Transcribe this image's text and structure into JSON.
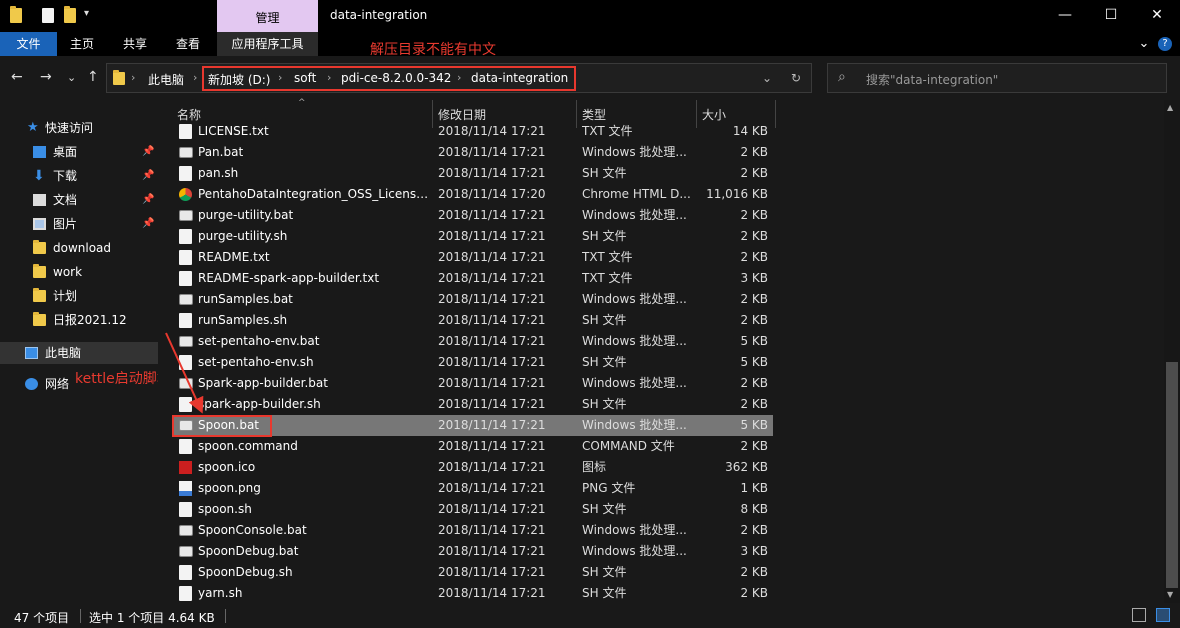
{
  "window": {
    "title": "data-integration",
    "context_tab": "管理",
    "minimize": "—",
    "maximize": "☐",
    "close": "✕"
  },
  "ribbon": {
    "tabs": [
      "文件",
      "主页",
      "共享",
      "查看",
      "应用程序工具"
    ],
    "collapse": "⌄",
    "help": "?"
  },
  "annotations": {
    "address_note": "解压目录不能有中文",
    "kettle_note": "kettle启动脚本"
  },
  "nav": {
    "back": "←",
    "forward": "→",
    "recent": "⌄",
    "up": "↑"
  },
  "address": {
    "crumbs": [
      "此电脑",
      "新加坡 (D:)",
      "soft",
      "pdi-ce-8.2.0.0-342",
      "data-integration"
    ],
    "separator": "›",
    "dropdown": "⌄",
    "refresh": "↻"
  },
  "search": {
    "placeholder": "搜索\"data-integration\"",
    "icon": "⌕"
  },
  "navpane": {
    "quick_access": "快速访问",
    "items": [
      {
        "label": "桌面",
        "pinned": true
      },
      {
        "label": "下载",
        "pinned": true
      },
      {
        "label": "文档",
        "pinned": true
      },
      {
        "label": "图片",
        "pinned": true
      },
      {
        "label": "download",
        "pinned": false
      },
      {
        "label": "work",
        "pinned": false
      },
      {
        "label": "计划",
        "pinned": false
      },
      {
        "label": "日报2021.12",
        "pinned": false
      }
    ],
    "this_pc": "此电脑",
    "network": "网络",
    "pin_glyph": "📌"
  },
  "columns": {
    "name": "名称",
    "date": "修改日期",
    "type": "类型",
    "size": "大小"
  },
  "files": [
    {
      "name": "LICENSE.txt",
      "date": "2018/11/14 17:21",
      "type": "TXT 文件",
      "size": "14 KB",
      "icon": "txt"
    },
    {
      "name": "Pan.bat",
      "date": "2018/11/14 17:21",
      "type": "Windows 批处理...",
      "size": "2 KB",
      "icon": "bat"
    },
    {
      "name": "pan.sh",
      "date": "2018/11/14 17:21",
      "type": "SH 文件",
      "size": "2 KB",
      "icon": "txt"
    },
    {
      "name": "PentahoDataIntegration_OSS_License...",
      "date": "2018/11/14 17:20",
      "type": "Chrome HTML D...",
      "size": "11,016 KB",
      "icon": "chrome"
    },
    {
      "name": "purge-utility.bat",
      "date": "2018/11/14 17:21",
      "type": "Windows 批处理...",
      "size": "2 KB",
      "icon": "bat"
    },
    {
      "name": "purge-utility.sh",
      "date": "2018/11/14 17:21",
      "type": "SH 文件",
      "size": "2 KB",
      "icon": "txt"
    },
    {
      "name": "README.txt",
      "date": "2018/11/14 17:21",
      "type": "TXT 文件",
      "size": "2 KB",
      "icon": "txt"
    },
    {
      "name": "README-spark-app-builder.txt",
      "date": "2018/11/14 17:21",
      "type": "TXT 文件",
      "size": "3 KB",
      "icon": "txt"
    },
    {
      "name": "runSamples.bat",
      "date": "2018/11/14 17:21",
      "type": "Windows 批处理...",
      "size": "2 KB",
      "icon": "bat"
    },
    {
      "name": "runSamples.sh",
      "date": "2018/11/14 17:21",
      "type": "SH 文件",
      "size": "2 KB",
      "icon": "txt"
    },
    {
      "name": "set-pentaho-env.bat",
      "date": "2018/11/14 17:21",
      "type": "Windows 批处理...",
      "size": "5 KB",
      "icon": "bat"
    },
    {
      "name": "set-pentaho-env.sh",
      "date": "2018/11/14 17:21",
      "type": "SH 文件",
      "size": "5 KB",
      "icon": "txt"
    },
    {
      "name": "Spark-app-builder.bat",
      "date": "2018/11/14 17:21",
      "type": "Windows 批处理...",
      "size": "2 KB",
      "icon": "bat"
    },
    {
      "name": "spark-app-builder.sh",
      "date": "2018/11/14 17:21",
      "type": "SH 文件",
      "size": "2 KB",
      "icon": "txt"
    },
    {
      "name": "Spoon.bat",
      "date": "2018/11/14 17:21",
      "type": "Windows 批处理...",
      "size": "5 KB",
      "icon": "bat",
      "selected": true
    },
    {
      "name": "spoon.command",
      "date": "2018/11/14 17:21",
      "type": "COMMAND 文件",
      "size": "2 KB",
      "icon": "txt"
    },
    {
      "name": "spoon.ico",
      "date": "2018/11/14 17:21",
      "type": "图标",
      "size": "362 KB",
      "icon": "ico"
    },
    {
      "name": "spoon.png",
      "date": "2018/11/14 17:21",
      "type": "PNG 文件",
      "size": "1 KB",
      "icon": "png"
    },
    {
      "name": "spoon.sh",
      "date": "2018/11/14 17:21",
      "type": "SH 文件",
      "size": "8 KB",
      "icon": "txt"
    },
    {
      "name": "SpoonConsole.bat",
      "date": "2018/11/14 17:21",
      "type": "Windows 批处理...",
      "size": "2 KB",
      "icon": "bat"
    },
    {
      "name": "SpoonDebug.bat",
      "date": "2018/11/14 17:21",
      "type": "Windows 批处理...",
      "size": "3 KB",
      "icon": "bat"
    },
    {
      "name": "SpoonDebug.sh",
      "date": "2018/11/14 17:21",
      "type": "SH 文件",
      "size": "2 KB",
      "icon": "txt"
    },
    {
      "name": "yarn.sh",
      "date": "2018/11/14 17:21",
      "type": "SH 文件",
      "size": "2 KB",
      "icon": "txt"
    }
  ],
  "status": {
    "count": "47 个项目",
    "selected": "选中 1 个项目  4.64 KB"
  },
  "colors": {
    "annotation": "#e8382e",
    "manage_tab": "#e3c8f1",
    "file_tab": "#1a63b8",
    "selected_row": "#777777"
  }
}
